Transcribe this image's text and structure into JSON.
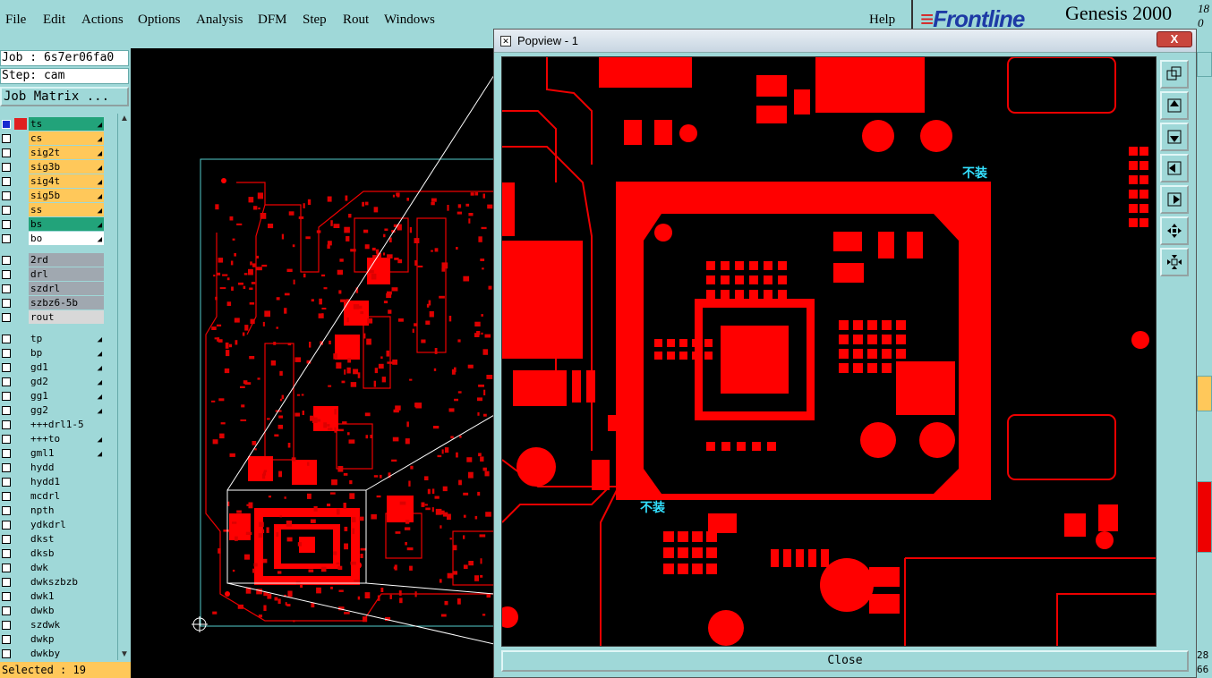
{
  "menu": {
    "file": "File",
    "edit": "Edit",
    "actions": "Actions",
    "options": "Options",
    "analysis": "Analysis",
    "dfm": "DFM",
    "step": "Step",
    "rout": "Rout",
    "windows": "Windows",
    "help": "Help"
  },
  "brand": {
    "logo": "Frontline",
    "title": "Genesis 2000",
    "sup": "18",
    "sub": "0"
  },
  "job": {
    "job_label": "Job : 6s7er06fa0",
    "step_label": "Step: cam",
    "matrix_button": "Job Matrix ..."
  },
  "layers": [
    {
      "name": "ts",
      "color": "#22a37a",
      "checked": true,
      "arrow": "▣"
    },
    {
      "name": "cs",
      "color": "#ffc85a",
      "checked": false,
      "arrow": "◆"
    },
    {
      "name": "sig2t",
      "color": "#ffc85a",
      "checked": false,
      "arrow": "◆"
    },
    {
      "name": "sig3b",
      "color": "#ffc85a",
      "checked": false,
      "arrow": "◆"
    },
    {
      "name": "sig4t",
      "color": "#ffc85a",
      "checked": false,
      "arrow": "◆"
    },
    {
      "name": "sig5b",
      "color": "#ffc85a",
      "checked": false,
      "arrow": "◆"
    },
    {
      "name": "ss",
      "color": "#ffc85a",
      "checked": false,
      "arrow": "◆"
    },
    {
      "name": "bs",
      "color": "#22a37a",
      "checked": false,
      "arrow": "◆"
    },
    {
      "name": "bo",
      "color": "#ffffff",
      "checked": false,
      "arrow": "◆"
    },
    {
      "name": "2rd",
      "color": "#a0a8b0",
      "checked": false,
      "arrow": ""
    },
    {
      "name": "drl",
      "color": "#a0a8b0",
      "checked": false,
      "arrow": ""
    },
    {
      "name": "szdrl",
      "color": "#a0a8b0",
      "checked": false,
      "arrow": ""
    },
    {
      "name": "szbz6-5b",
      "color": "#a0a8b0",
      "checked": false,
      "arrow": ""
    },
    {
      "name": "rout",
      "color": "#d8d8d8",
      "checked": false,
      "arrow": ""
    },
    {
      "name": "tp",
      "color": "#9fd8d8",
      "checked": false,
      "arrow": "◆"
    },
    {
      "name": "bp",
      "color": "#9fd8d8",
      "checked": false,
      "arrow": "◆"
    },
    {
      "name": "gd1",
      "color": "#9fd8d8",
      "checked": false,
      "arrow": "◆"
    },
    {
      "name": "gd2",
      "color": "#9fd8d8",
      "checked": false,
      "arrow": "◆"
    },
    {
      "name": "gg1",
      "color": "#9fd8d8",
      "checked": false,
      "arrow": "◆"
    },
    {
      "name": "gg2",
      "color": "#9fd8d8",
      "checked": false,
      "arrow": "◆"
    },
    {
      "name": "+++drl1-5",
      "color": "#9fd8d8",
      "checked": false,
      "arrow": ""
    },
    {
      "name": "+++to",
      "color": "#9fd8d8",
      "checked": false,
      "arrow": "◆"
    },
    {
      "name": "gml1",
      "color": "#9fd8d8",
      "checked": false,
      "arrow": "◆"
    },
    {
      "name": "hydd",
      "color": "#9fd8d8",
      "checked": false,
      "arrow": ""
    },
    {
      "name": "hydd1",
      "color": "#9fd8d8",
      "checked": false,
      "arrow": ""
    },
    {
      "name": "mcdrl",
      "color": "#9fd8d8",
      "checked": false,
      "arrow": ""
    },
    {
      "name": "npth",
      "color": "#9fd8d8",
      "checked": false,
      "arrow": ""
    },
    {
      "name": "ydkdrl",
      "color": "#9fd8d8",
      "checked": false,
      "arrow": ""
    },
    {
      "name": "dkst",
      "color": "#9fd8d8",
      "checked": false,
      "arrow": ""
    },
    {
      "name": "dksb",
      "color": "#9fd8d8",
      "checked": false,
      "arrow": ""
    },
    {
      "name": "dwk",
      "color": "#9fd8d8",
      "checked": false,
      "arrow": ""
    },
    {
      "name": "dwkszbzb",
      "color": "#9fd8d8",
      "checked": false,
      "arrow": ""
    },
    {
      "name": "dwk1",
      "color": "#9fd8d8",
      "checked": false,
      "arrow": ""
    },
    {
      "name": "dwkb",
      "color": "#9fd8d8",
      "checked": false,
      "arrow": ""
    },
    {
      "name": "szdwk",
      "color": "#9fd8d8",
      "checked": false,
      "arrow": ""
    },
    {
      "name": "dwkp",
      "color": "#9fd8d8",
      "checked": false,
      "arrow": ""
    },
    {
      "name": "dwkby",
      "color": "#9fd8d8",
      "checked": false,
      "arrow": ""
    }
  ],
  "status": {
    "selected": "Selected : 19"
  },
  "popup": {
    "title": "Popview - 1",
    "close_label": "Close",
    "close_x": "X",
    "annotation": "不装"
  },
  "right_strip": {
    "num1": "28",
    "num2": "66"
  },
  "colors": {
    "copper": "#ff0000",
    "background": "#000000",
    "panel": "#9fd8d8",
    "annotation": "#33e0ff"
  }
}
